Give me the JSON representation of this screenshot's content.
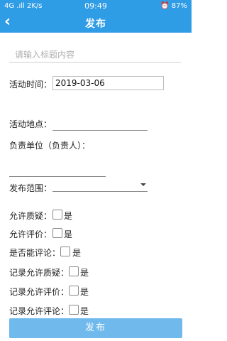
{
  "status": {
    "left": "4G .ıll 2K/s",
    "time": "09:49",
    "right": "⏰ 87%"
  },
  "nav": {
    "title": "发布",
    "back": "‹"
  },
  "form": {
    "title_placeholder": "请输入标题内容",
    "time_label": "活动时间：",
    "time_value": "2019-03-06",
    "location_label": "活动地点：",
    "unit_label": "负责单位（负责人）：",
    "scope_label": "发布范围：",
    "scope_value": ""
  },
  "options": [
    {
      "label": "允许质疑：",
      "yes": "是"
    },
    {
      "label": "允许评价：",
      "yes": "是"
    },
    {
      "label": "是否能评论：",
      "yes": "是"
    },
    {
      "label": "记录允许质疑：",
      "yes": "是"
    },
    {
      "label": "记录允许评价：",
      "yes": "是"
    },
    {
      "label": "记录允许评论：",
      "yes": "是"
    }
  ],
  "submit_label": "发布"
}
